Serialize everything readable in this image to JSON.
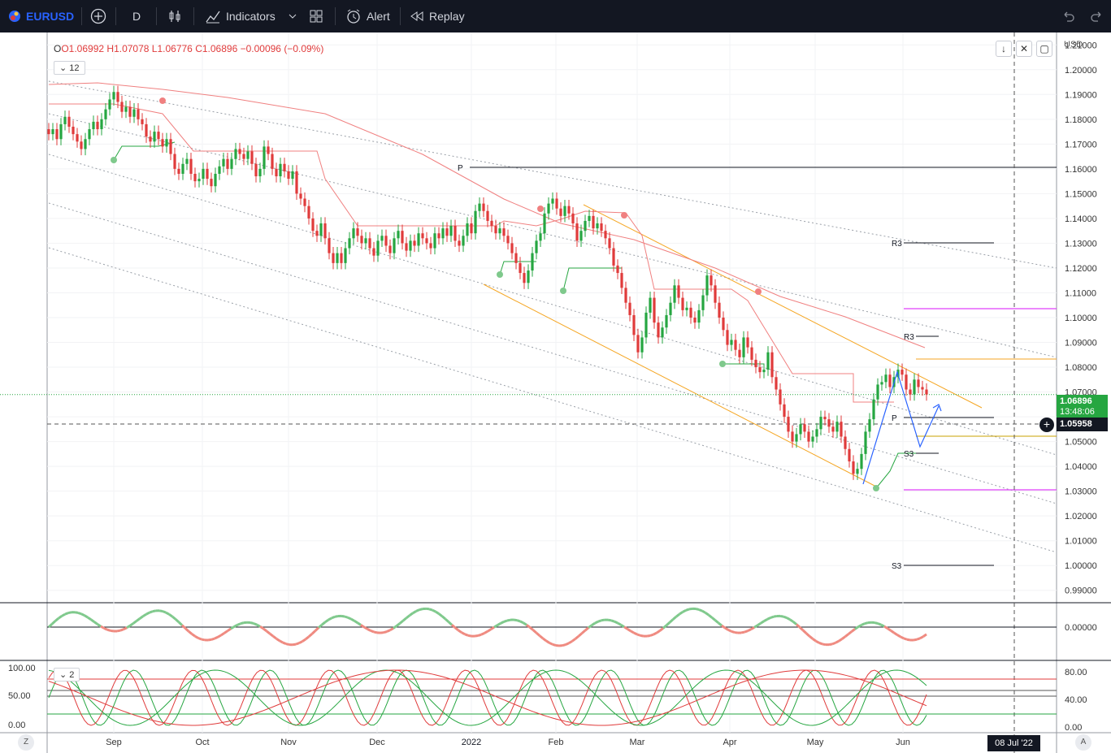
{
  "toolbar": {
    "symbol": "EURUSD",
    "interval": "D",
    "indicators_label": "Indicators",
    "alert_label": "Alert",
    "replay_label": "Replay"
  },
  "legend": {
    "open": "O1.06992",
    "high": "H1.07078",
    "low": "L1.06776",
    "close": "C1.06896",
    "change": "−0.00096 (−0.09%)",
    "indicator_tag": "12",
    "osc_tag": "2"
  },
  "price_axis": {
    "currency": "USD",
    "labels": [
      "1.21000",
      "1.20000",
      "1.19000",
      "1.18000",
      "1.17000",
      "1.16000",
      "1.15000",
      "1.14000",
      "1.13000",
      "1.12000",
      "1.11000",
      "1.10000",
      "1.09000",
      "1.08000",
      "1.07000",
      "1.06000",
      "1.05000",
      "1.04000",
      "1.03000",
      "1.02000",
      "1.01000",
      "1.00000",
      "0.99000"
    ],
    "last_price": "1.06896",
    "countdown": "13:48:06",
    "crosshair_price": "1.05958",
    "osc_zero": "0.00000",
    "stoch_right": [
      "80.00",
      "40.00",
      "0.00"
    ],
    "stoch_left": [
      "100.00",
      "50.00",
      "0.00"
    ]
  },
  "time_axis": {
    "labels": [
      "Sep",
      "Oct",
      "Nov",
      "Dec",
      "2022",
      "Feb",
      "Mar",
      "Apr",
      "May",
      "Jun"
    ],
    "crosshair_date": "08 Jul '22",
    "left_btn": "Z",
    "right_btn": "A"
  },
  "pivots": {
    "P_weekly": "P",
    "R3_a": "R3",
    "R3_b": "R3",
    "P_b": "P",
    "S3_a": "S3",
    "S3_b": "S3"
  },
  "colors": {
    "up": "#26a641",
    "down": "#e03b3b",
    "accent": "#2962ff",
    "toolbar_bg": "#131722"
  },
  "chart_data": {
    "type": "candlestick",
    "symbol": "EURUSD",
    "interval": "D",
    "ylim": [
      0.985,
      1.215
    ],
    "closes": [
      1.174,
      1.176,
      1.172,
      1.178,
      1.181,
      1.177,
      1.174,
      1.171,
      1.168,
      1.172,
      1.176,
      1.179,
      1.176,
      1.18,
      1.184,
      1.188,
      1.191,
      1.187,
      1.183,
      1.185,
      1.181,
      1.184,
      1.18,
      1.178,
      1.173,
      1.171,
      1.175,
      1.172,
      1.169,
      1.172,
      1.166,
      1.16,
      1.158,
      1.162,
      1.164,
      1.158,
      1.155,
      1.156,
      1.16,
      1.156,
      1.153,
      1.158,
      1.161,
      1.164,
      1.16,
      1.164,
      1.168,
      1.166,
      1.164,
      1.167,
      1.162,
      1.157,
      1.16,
      1.169,
      1.166,
      1.16,
      1.157,
      1.162,
      1.159,
      1.156,
      1.159,
      1.15,
      1.148,
      1.145,
      1.14,
      1.135,
      1.133,
      1.138,
      1.132,
      1.126,
      1.122,
      1.126,
      1.122,
      1.128,
      1.132,
      1.136,
      1.133,
      1.13,
      1.132,
      1.128,
      1.125,
      1.131,
      1.133,
      1.129,
      1.126,
      1.132,
      1.135,
      1.13,
      1.127,
      1.131,
      1.129,
      1.134,
      1.132,
      1.13,
      1.128,
      1.134,
      1.132,
      1.136,
      1.133,
      1.137,
      1.131,
      1.129,
      1.133,
      1.138,
      1.134,
      1.143,
      1.146,
      1.143,
      1.139,
      1.137,
      1.134,
      1.136,
      1.133,
      1.13,
      1.126,
      1.122,
      1.118,
      1.114,
      1.119,
      1.126,
      1.131,
      1.134,
      1.142,
      1.146,
      1.148,
      1.144,
      1.141,
      1.145,
      1.142,
      1.138,
      1.131,
      1.135,
      1.139,
      1.141,
      1.136,
      1.138,
      1.135,
      1.132,
      1.128,
      1.121,
      1.118,
      1.112,
      1.106,
      1.101,
      1.093,
      1.086,
      1.092,
      1.102,
      1.108,
      1.098,
      1.092,
      1.096,
      1.101,
      1.106,
      1.113,
      1.108,
      1.103,
      1.104,
      1.1,
      1.098,
      1.103,
      1.109,
      1.117,
      1.113,
      1.106,
      1.1,
      1.095,
      1.089,
      1.091,
      1.087,
      1.084,
      1.092,
      1.088,
      1.083,
      1.08,
      1.078,
      1.079,
      1.086,
      1.076,
      1.071,
      1.065,
      1.06,
      1.054,
      1.05,
      1.053,
      1.057,
      1.054,
      1.05,
      1.052,
      1.055,
      1.06,
      1.059,
      1.056,
      1.054,
      1.058,
      1.052,
      1.047,
      1.042,
      1.037,
      1.039,
      1.045,
      1.054,
      1.059,
      1.067,
      1.073,
      1.074,
      1.077,
      1.072,
      1.076,
      1.079,
      1.077,
      1.071,
      1.069,
      1.075,
      1.072,
      1.071,
      1.069
    ]
  }
}
